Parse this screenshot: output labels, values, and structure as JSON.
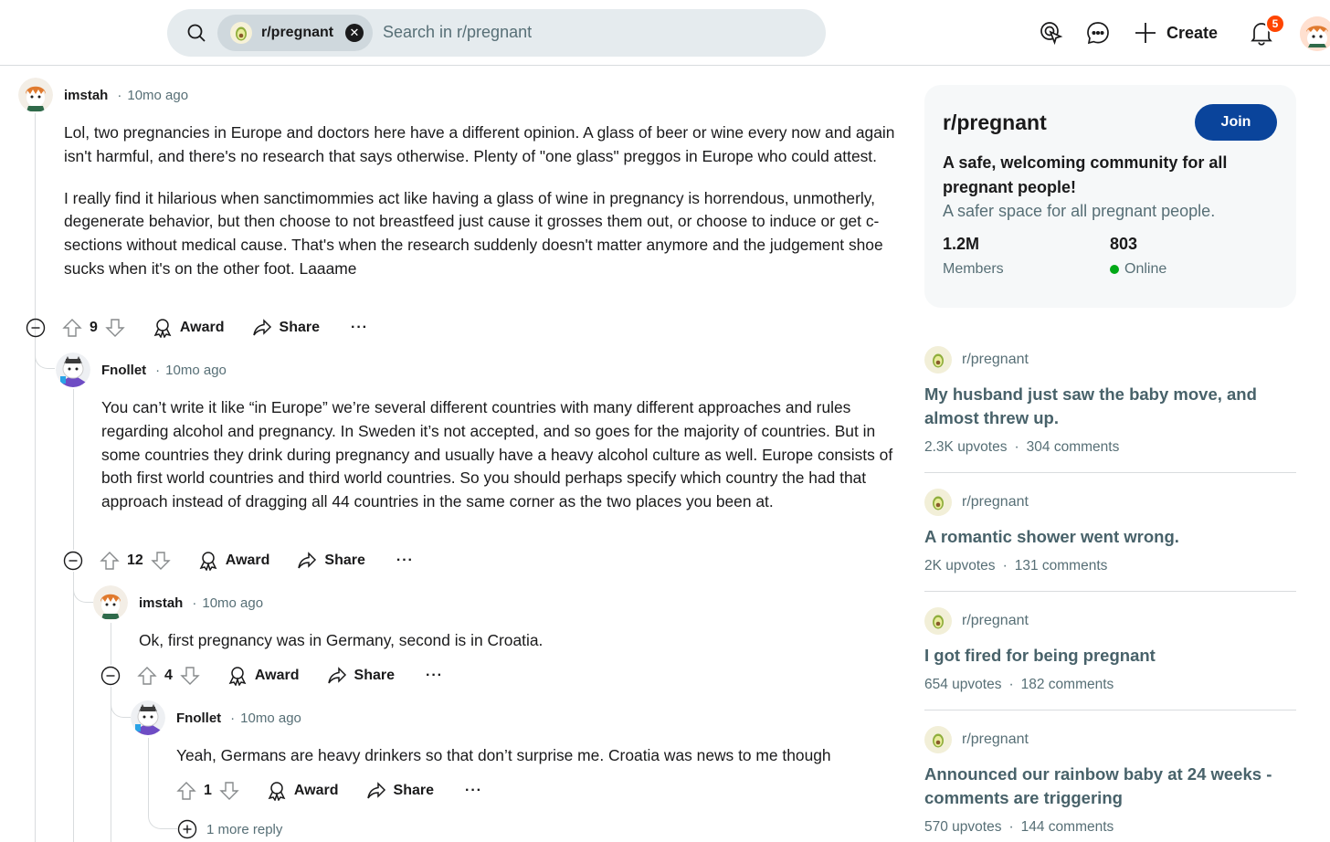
{
  "header": {
    "community_chip": "r/pregnant",
    "search_placeholder": "Search in r/pregnant",
    "create_label": "Create",
    "notification_count": "5"
  },
  "comments": [
    {
      "user": "imstah",
      "time": "10mo ago",
      "paragraphs": [
        "Lol, two pregnancies in Europe and doctors here have a different opinion. A glass of beer or wine every now and again isn't harmful, and there's no research that says otherwise. Plenty of \"one glass\" preggos in Europe who could attest.",
        "I really find it hilarious when sanctimommies act like having a glass of wine in pregnancy is horrendous, unmotherly, degenerate behavior, but then choose to not breastfeed just cause it grosses them out, or choose to induce or get c-sections without medical cause. That's when the research suddenly doesn't matter anymore and the judgement shoe sucks when it's on the other foot. Laaame"
      ],
      "votes": "9",
      "award": "Award",
      "share": "Share",
      "more": "···"
    },
    {
      "user": "Fnollet",
      "time": "10mo ago",
      "paragraphs": [
        "You can’t write it like “in Europe” we’re several different countries with many different approaches and rules regarding alcohol and pregnancy. In Sweden it’s not accepted, and so goes for the majority of countries. But in some countries they drink during pregnancy and usually have a heavy alcohol culture as well. Europe consists of both first world countries and third world countries. So you should perhaps specify which country the had that approach instead of dragging all 44 countries in the same corner as the two places you been at."
      ],
      "votes": "12",
      "award": "Award",
      "share": "Share",
      "more": "···"
    },
    {
      "user": "imstah",
      "time": "10mo ago",
      "paragraphs": [
        "Ok, first pregnancy was in Germany, second is in Croatia."
      ],
      "votes": "4",
      "award": "Award",
      "share": "Share",
      "more": "···"
    },
    {
      "user": "Fnollet",
      "time": "10mo ago",
      "paragraphs": [
        "Yeah, Germans are heavy drinkers so that don’t surprise me. Croatia was news to me though"
      ],
      "votes": "1",
      "award": "Award",
      "share": "Share",
      "more": "···"
    }
  ],
  "more_reply": "1 more reply",
  "sidebar": {
    "community": {
      "name": "r/pregnant",
      "join_label": "Join",
      "tagline": "A safe, welcoming community for all pregnant people!",
      "description": "A safer space for all pregnant people.",
      "members_count": "1.2M",
      "members_label": "Members",
      "online_count": "803",
      "online_label": "Online"
    },
    "posts": [
      {
        "subreddit": "r/pregnant",
        "title": "My husband just saw the baby move, and almost threw up.",
        "upvotes": "2.3K upvotes",
        "comments": "304 comments"
      },
      {
        "subreddit": "r/pregnant",
        "title": "A romantic shower went wrong.",
        "upvotes": "2K upvotes",
        "comments": "131 comments"
      },
      {
        "subreddit": "r/pregnant",
        "title": "I got fired for being pregnant",
        "upvotes": "654 upvotes",
        "comments": "182 comments"
      },
      {
        "subreddit": "r/pregnant",
        "title": "Announced our rainbow baby at 24 weeks - comments are triggering",
        "upvotes": "570 upvotes",
        "comments": "144 comments"
      }
    ]
  },
  "colors": {
    "join_button": "#0a449b",
    "badge": "#ff4500",
    "online": "#01a816",
    "search_bg": "#e5ebee"
  }
}
